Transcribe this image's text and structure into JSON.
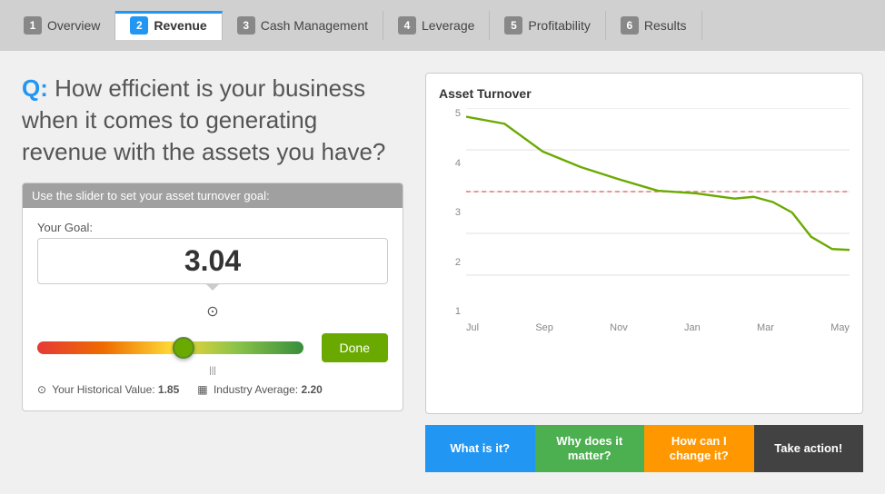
{
  "nav": {
    "steps": [
      {
        "num": "1",
        "label": "Overview",
        "active": false
      },
      {
        "num": "2",
        "label": "Revenue",
        "active": true
      },
      {
        "num": "3",
        "label": "Cash Management",
        "active": false
      },
      {
        "num": "4",
        "label": "Leverage",
        "active": false
      },
      {
        "num": "5",
        "label": "Profitability",
        "active": false
      },
      {
        "num": "6",
        "label": "Results",
        "active": false
      }
    ]
  },
  "question": {
    "prefix": "Q:",
    "text": " How efficient is your business when it comes to generating revenue with the assets you have?"
  },
  "slider_box": {
    "header": "Use the slider to set your asset turnover goal:",
    "goal_label": "Your Goal:",
    "goal_value": "3.04",
    "done_label": "Done"
  },
  "stats": {
    "historical_label": "Your Historical Value:",
    "historical_value": "1.85",
    "industry_label": "Industry Average:",
    "industry_value": "2.20"
  },
  "chart": {
    "title": "Asset Turnover",
    "y_labels": [
      "5",
      "4",
      "3",
      "2",
      "1"
    ],
    "x_labels": [
      "Jul",
      "Sep",
      "Nov",
      "Jan",
      "Mar",
      "May"
    ]
  },
  "action_tabs": [
    {
      "label": "What is it?",
      "color": "tab-blue"
    },
    {
      "label": "Why does it matter?",
      "color": "tab-green"
    },
    {
      "label": "How can I change it?",
      "color": "tab-orange"
    },
    {
      "label": "Take action!",
      "color": "tab-dark"
    }
  ]
}
